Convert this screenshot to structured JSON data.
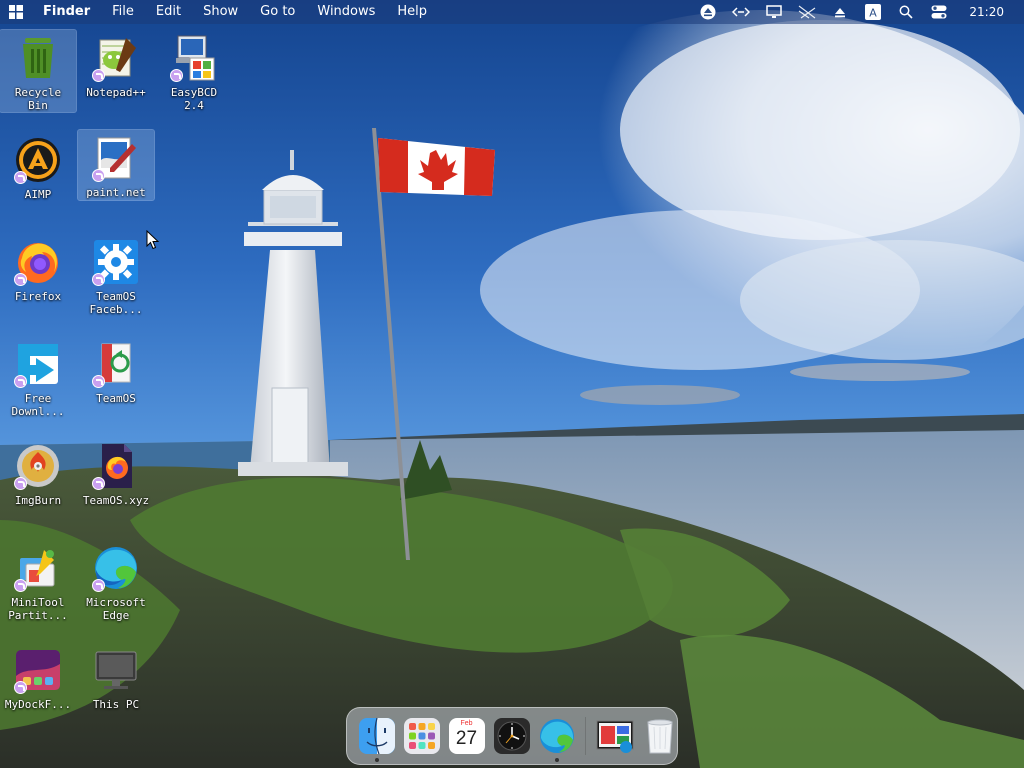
{
  "menubar": {
    "items": [
      "Finder",
      "File",
      "Edit",
      "Show",
      "Go to",
      "Windows",
      "Help"
    ],
    "status_icons": [
      "eject-icon",
      "code-arrows-icon",
      "monitor-icon",
      "network-icon",
      "upload-icon",
      "keyboard-layout-icon",
      "search-icon",
      "control-center-icon"
    ],
    "input_letter": "A",
    "clock": "21:20"
  },
  "desktop": {
    "icons": [
      {
        "label": "Recycle\nBin",
        "icon": "recycle-bin-icon",
        "selected": true
      },
      {
        "label": "Notepad++",
        "icon": "notepad-plus-plus-icon"
      },
      {
        "label": "EasyBCD\n2.4",
        "icon": "easybcd-icon"
      },
      {
        "label": "AIMP",
        "icon": "aimp-icon"
      },
      {
        "label": "paint.net",
        "icon": "paint-net-icon",
        "selected": true
      },
      {
        "label": "Firefox",
        "icon": "firefox-icon"
      },
      {
        "label": "TeamOS\nFaceb...",
        "icon": "gear-icon"
      },
      {
        "label": "Free\nDownl...",
        "icon": "free-download-manager-icon"
      },
      {
        "label": "TeamOS",
        "icon": "teamos-icon"
      },
      {
        "label": "ImgBurn",
        "icon": "imgburn-icon"
      },
      {
        "label": "TeamOS.xyz",
        "icon": "teamos-xyz-icon"
      },
      {
        "label": "MiniTool\nPartit...",
        "icon": "minitool-icon"
      },
      {
        "label": "Microsoft\nEdge",
        "icon": "edge-icon"
      },
      {
        "label": "MyDockF...",
        "icon": "mydockfinder-icon"
      },
      {
        "label": "This PC",
        "icon": "this-pc-icon"
      }
    ]
  },
  "dock": {
    "calendar_month": "Feb",
    "calendar_day": "27",
    "items": [
      "finder-icon",
      "launchpad-icon",
      "calendar-icon",
      "clock-icon",
      "edge-icon",
      "teamos-window-icon",
      "trash-icon"
    ]
  },
  "colors": {
    "sky_top": "#1d4f9e",
    "sky_mid": "#3b7fcf",
    "sea": "#6f8fb0",
    "flag_red": "#d52b1e"
  }
}
